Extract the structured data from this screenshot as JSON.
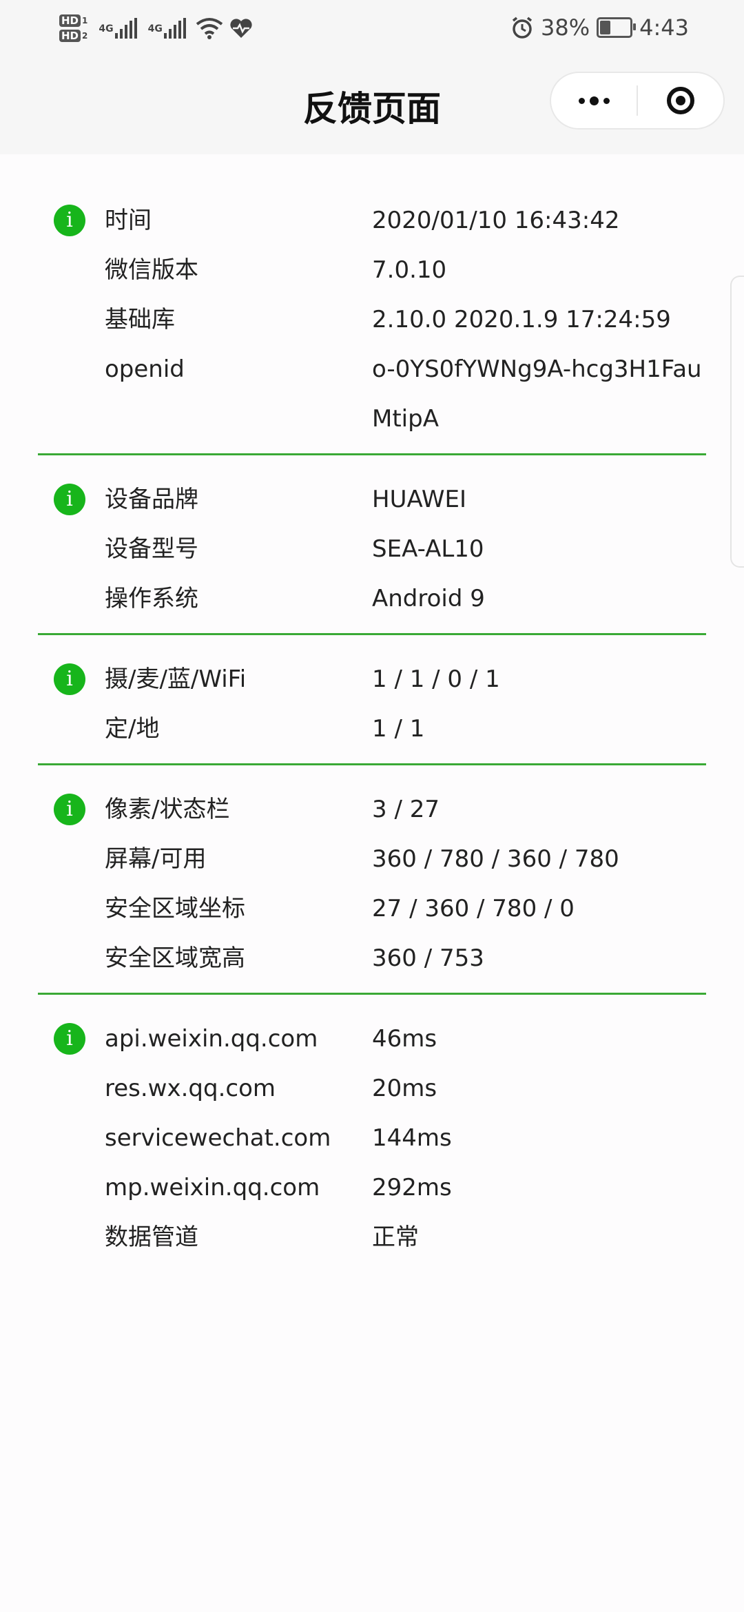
{
  "status_bar": {
    "sim1_label": "HD",
    "sim1_num": "1",
    "sim2_label": "HD",
    "sim2_num": "2",
    "network1": "4G",
    "network2": "4G",
    "battery_percent": "38%",
    "battery_level": 0.38,
    "time": "4:43",
    "icons": [
      "alarm-icon",
      "wifi-icon",
      "heart-icon",
      "battery-icon"
    ]
  },
  "nav": {
    "title": "反馈页面",
    "capsule_icons": [
      "more-icon",
      "close-icon"
    ]
  },
  "sections": [
    {
      "rows": [
        {
          "key": "时间",
          "value": "2020/01/10 16:43:42"
        },
        {
          "key": "微信版本",
          "value": "7.0.10"
        },
        {
          "key": "基础库",
          "value": "2.10.0 2020.1.9 17:24:59"
        },
        {
          "key": "openid",
          "value": "o-0YS0fYWNg9A-hcg3H1Fau"
        },
        {
          "key": "",
          "value": "MtipA"
        }
      ]
    },
    {
      "rows": [
        {
          "key": "设备品牌",
          "value": "HUAWEI"
        },
        {
          "key": "设备型号",
          "value": "SEA-AL10"
        },
        {
          "key": "操作系统",
          "value": "Android 9"
        }
      ]
    },
    {
      "rows": [
        {
          "key": "摄/麦/蓝/WiFi",
          "value": "1 / 1 / 0 / 1"
        },
        {
          "key": "定/地",
          "value": "1 / 1"
        }
      ]
    },
    {
      "rows": [
        {
          "key": "像素/状态栏",
          "value": "3 / 27"
        },
        {
          "key": "屏幕/可用",
          "value": "360 / 780 / 360 / 780"
        },
        {
          "key": "安全区域坐标",
          "value": "27 / 360 / 780 / 0"
        },
        {
          "key": "安全区域宽高",
          "value": "360 / 753"
        }
      ]
    },
    {
      "rows": [
        {
          "key": "api.weixin.qq.com",
          "value": "46ms"
        },
        {
          "key": "res.wx.qq.com",
          "value": "20ms"
        },
        {
          "key": "servicewechat.com",
          "value": "144ms"
        },
        {
          "key": "mp.weixin.qq.com",
          "value": "292ms"
        },
        {
          "key": "数据管道",
          "value": "正常"
        }
      ]
    }
  ],
  "info_icon_glyph": "i",
  "colors": {
    "accent_green": "#17b51b",
    "divider_green": "#3aa935",
    "background": "#fdfcfd",
    "header_bg": "#f6f6f6"
  }
}
